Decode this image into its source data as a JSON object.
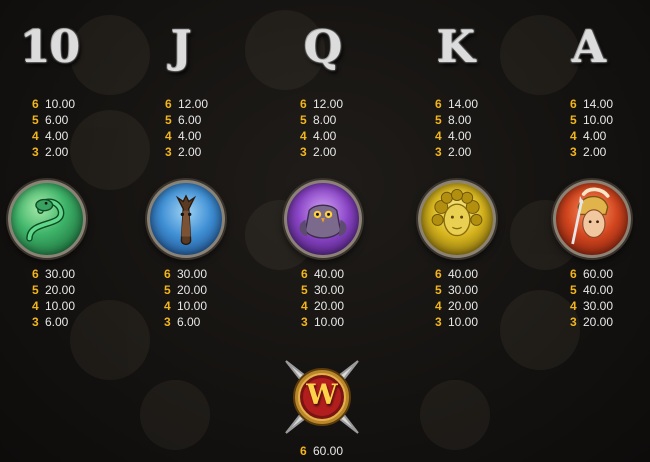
{
  "letters": [
    {
      "symbol": "10",
      "pays": [
        {
          "count": "6",
          "value": "10.00"
        },
        {
          "count": "5",
          "value": "6.00"
        },
        {
          "count": "4",
          "value": "4.00"
        },
        {
          "count": "3",
          "value": "2.00"
        }
      ]
    },
    {
      "symbol": "J",
      "pays": [
        {
          "count": "6",
          "value": "12.00"
        },
        {
          "count": "5",
          "value": "6.00"
        },
        {
          "count": "4",
          "value": "4.00"
        },
        {
          "count": "3",
          "value": "2.00"
        }
      ]
    },
    {
      "symbol": "Q",
      "pays": [
        {
          "count": "6",
          "value": "12.00"
        },
        {
          "count": "5",
          "value": "8.00"
        },
        {
          "count": "4",
          "value": "4.00"
        },
        {
          "count": "3",
          "value": "2.00"
        }
      ]
    },
    {
      "symbol": "K",
      "pays": [
        {
          "count": "6",
          "value": "14.00"
        },
        {
          "count": "5",
          "value": "8.00"
        },
        {
          "count": "4",
          "value": "4.00"
        },
        {
          "count": "3",
          "value": "2.00"
        }
      ]
    },
    {
      "symbol": "A",
      "pays": [
        {
          "count": "6",
          "value": "14.00"
        },
        {
          "count": "5",
          "value": "10.00"
        },
        {
          "count": "4",
          "value": "4.00"
        },
        {
          "count": "3",
          "value": "2.00"
        }
      ]
    }
  ],
  "premiums": [
    {
      "icon": "snake-icon",
      "color": "#2fae5a",
      "pays": [
        {
          "count": "6",
          "value": "30.00"
        },
        {
          "count": "5",
          "value": "20.00"
        },
        {
          "count": "4",
          "value": "10.00"
        },
        {
          "count": "3",
          "value": "6.00"
        }
      ]
    },
    {
      "icon": "horse-icon",
      "color": "#3d8fd6",
      "pays": [
        {
          "count": "6",
          "value": "30.00"
        },
        {
          "count": "5",
          "value": "20.00"
        },
        {
          "count": "4",
          "value": "10.00"
        },
        {
          "count": "3",
          "value": "6.00"
        }
      ]
    },
    {
      "icon": "owl-icon",
      "color": "#8b45c7",
      "pays": [
        {
          "count": "6",
          "value": "40.00"
        },
        {
          "count": "5",
          "value": "30.00"
        },
        {
          "count": "4",
          "value": "20.00"
        },
        {
          "count": "3",
          "value": "10.00"
        }
      ]
    },
    {
      "icon": "medusa-icon",
      "color": "#d7b51e",
      "pays": [
        {
          "count": "6",
          "value": "40.00"
        },
        {
          "count": "5",
          "value": "30.00"
        },
        {
          "count": "4",
          "value": "20.00"
        },
        {
          "count": "3",
          "value": "10.00"
        }
      ]
    },
    {
      "icon": "warrior-icon",
      "color": "#d2461f",
      "pays": [
        {
          "count": "6",
          "value": "60.00"
        },
        {
          "count": "5",
          "value": "40.00"
        },
        {
          "count": "4",
          "value": "30.00"
        },
        {
          "count": "3",
          "value": "20.00"
        }
      ]
    }
  ],
  "wild": {
    "icon": "wild-icon",
    "letter": "W",
    "pays": [
      {
        "count": "6",
        "value": "60.00"
      }
    ]
  },
  "colors": {
    "count": "#f2b51c",
    "value": "#e8e8e8",
    "background": "#141210"
  }
}
